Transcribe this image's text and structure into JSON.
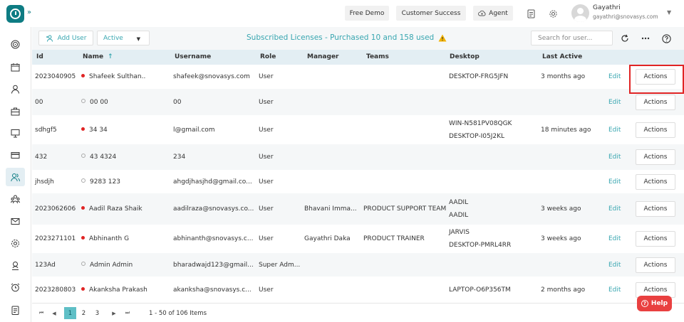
{
  "header": {
    "free_demo": "Free Demo",
    "customer_success": "Customer Success",
    "agent": "Agent",
    "user_name": "Gayathri",
    "user_email": "gayathri@snovasys.com"
  },
  "toolbar": {
    "add_user": "Add User",
    "status_filter": "Active",
    "license_text": "Subscribed Licenses - Purchased 10 and 158 used",
    "search_placeholder": "Search for user..."
  },
  "columns": [
    "Id",
    "Name",
    "Username",
    "Role",
    "Manager",
    "Teams",
    "Desktop",
    "Last Active"
  ],
  "rows": [
    {
      "id": "2023040905",
      "name": "Shafeek Sulthan..",
      "status": "red",
      "username": "shafeek@snovasys.com",
      "role": "User",
      "manager": "",
      "teams": "",
      "desktop": [
        "DESKTOP-FRG5JFN"
      ],
      "last_active": "3 months ago",
      "edit": "Edit",
      "actions": "Actions"
    },
    {
      "id": "00",
      "name": "00 00",
      "status": "hollow",
      "username": "00",
      "role": "User",
      "manager": "",
      "teams": "",
      "desktop": [],
      "last_active": "",
      "edit": "Edit",
      "actions": "Actions"
    },
    {
      "id": "sdhgf5",
      "name": "34 34",
      "status": "red",
      "username": "l@gmail.com",
      "role": "User",
      "manager": "",
      "teams": "",
      "desktop": [
        "WIN-N581PV08QGK",
        "DESKTOP-I05J2KL"
      ],
      "last_active": "18 minutes ago",
      "edit": "Edit",
      "actions": "Actions"
    },
    {
      "id": "432",
      "name": "43 4324",
      "status": "hollow",
      "username": "234",
      "role": "User",
      "manager": "",
      "teams": "",
      "desktop": [],
      "last_active": "",
      "edit": "Edit",
      "actions": "Actions"
    },
    {
      "id": "jhsdjh",
      "name": "9283 123",
      "status": "hollow",
      "username": "ahgdjhasjhd@gmail.co...",
      "role": "User",
      "manager": "",
      "teams": "",
      "desktop": [],
      "last_active": "",
      "edit": "Edit",
      "actions": "Actions"
    },
    {
      "id": "2023062606",
      "name": "Aadil Raza Shaik",
      "status": "red",
      "username": "aadilraza@snovasys.co...",
      "role": "User",
      "manager": "Bhavani Imma...",
      "teams": "PRODUCT SUPPORT TEAM",
      "desktop": [
        "AADIL",
        "AADIL"
      ],
      "last_active": "3 weeks ago",
      "edit": "Edit",
      "actions": "Actions"
    },
    {
      "id": "2023271101",
      "name": "Abhinanth G",
      "status": "red",
      "username": "abhinanth@snovasys.c...",
      "role": "User",
      "manager": "Gayathri Daka",
      "teams": "PRODUCT TRAINER",
      "desktop": [
        "JARVIS",
        "DESKTOP-PMRL4RR"
      ],
      "last_active": "3 weeks ago",
      "edit": "Edit",
      "actions": "Actions"
    },
    {
      "id": "123Ad",
      "name": "Admin Admin",
      "status": "hollow",
      "username": "bharadwajd123@gmail...",
      "role": "Super Adm...",
      "manager": "",
      "teams": "",
      "desktop": [],
      "last_active": "",
      "edit": "Edit",
      "actions": "Actions"
    },
    {
      "id": "2023280803",
      "name": "Akanksha Prakash",
      "status": "red",
      "username": "akanksha@snovasys.c...",
      "role": "User",
      "manager": "",
      "teams": "",
      "desktop": [
        "LAPTOP-O6P356TM"
      ],
      "last_active": "2 months ago",
      "edit": "Edit",
      "actions": "Actions"
    }
  ],
  "pagination": {
    "pages": [
      "1",
      "2",
      "3"
    ],
    "current": "1",
    "info": "1 - 50 of 106 Items"
  },
  "help": "Help",
  "colors": {
    "accent": "#38a6b0",
    "brand": "#0e7c83",
    "active_dot": "#e02424",
    "header_bg": "#e3eef3"
  }
}
